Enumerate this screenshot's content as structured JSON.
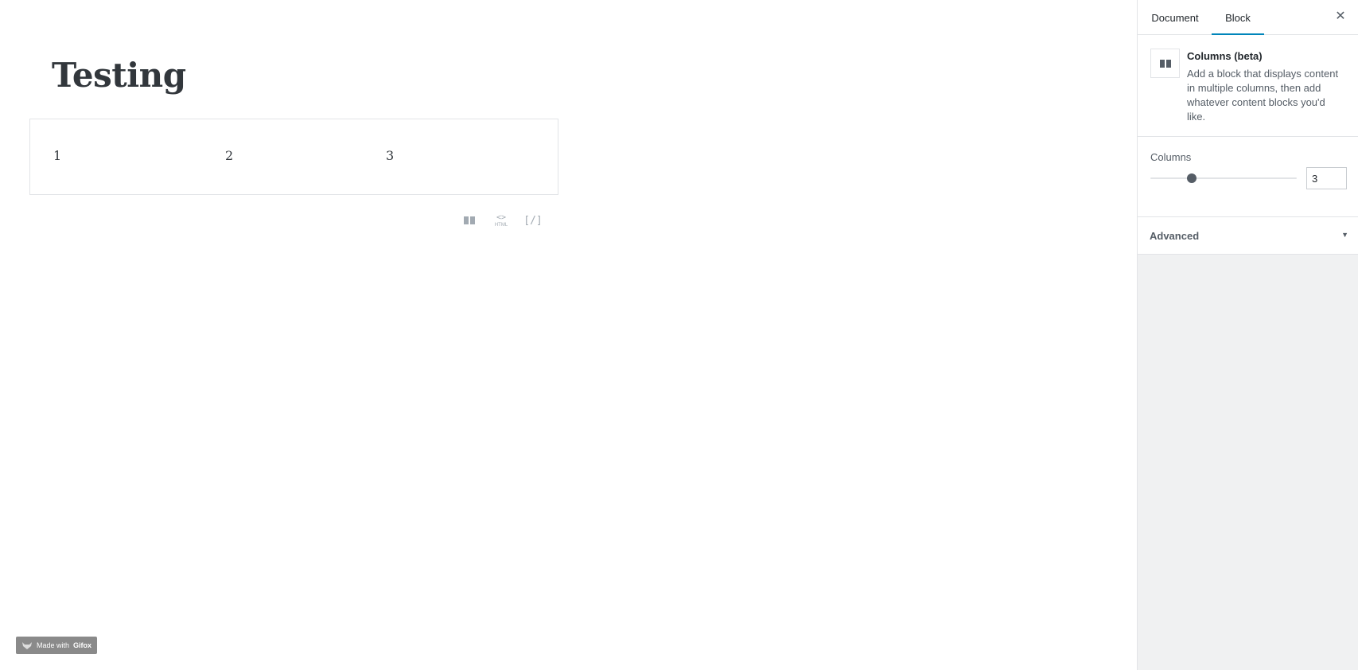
{
  "editor": {
    "title": "Testing",
    "columns": [
      "1",
      "2",
      "3"
    ],
    "toolbar": {
      "html_symbol": "<>",
      "html_label": "HTML",
      "shortcode_label": "[/]"
    }
  },
  "badge": {
    "prefix": "Made with",
    "brand": "Gifox"
  },
  "sidebar": {
    "tabs": [
      {
        "label": "Document",
        "active": false
      },
      {
        "label": "Block",
        "active": true
      }
    ],
    "close_symbol": "✕",
    "block": {
      "name": "Columns (beta)",
      "description": "Add a block that displays content in multiple columns, then add whatever content blocks you'd like."
    },
    "columns_setting": {
      "label": "Columns",
      "value": "3",
      "fraction": 0.28
    },
    "advanced": {
      "label": "Advanced",
      "arrow": "▼"
    }
  },
  "colors": {
    "accent": "#0085ba",
    "sidebar_bg": "#f0f1f2"
  }
}
